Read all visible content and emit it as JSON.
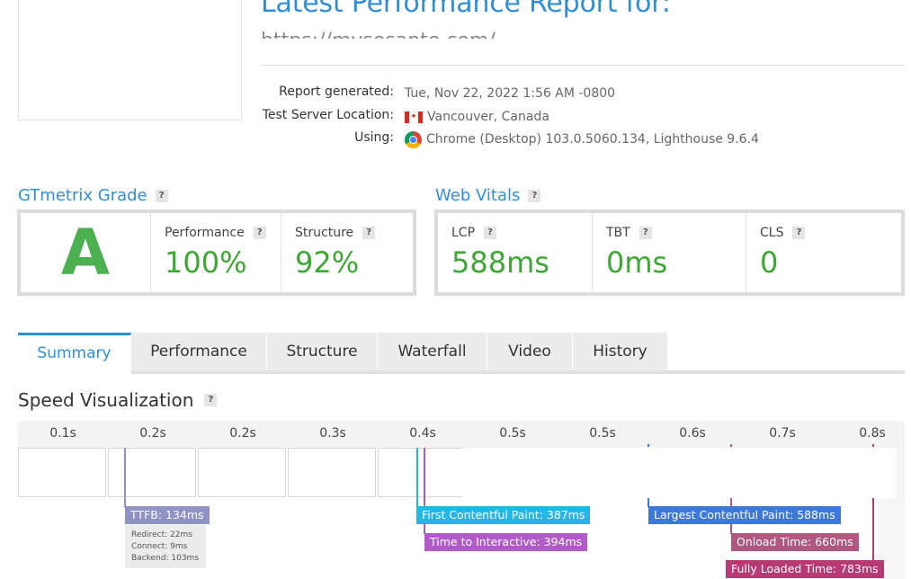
{
  "header": {
    "title": "Latest Performance Report for:",
    "url": "https://mysesante.com/"
  },
  "meta": {
    "report_generated_label": "Report generated:",
    "report_generated_value": "Tue, Nov 22, 2022 1:56 AM -0800",
    "server_location_label": "Test Server Location:",
    "server_location_value": "Vancouver, Canada",
    "using_label": "Using:",
    "using_value": "Chrome (Desktop) 103.0.5060.134, Lighthouse 9.6.4"
  },
  "grade": {
    "heading": "GTmetrix Grade",
    "letter": "A",
    "performance_label": "Performance",
    "performance_value": "100%",
    "structure_label": "Structure",
    "structure_value": "92%"
  },
  "vitals": {
    "heading": "Web Vitals",
    "lcp_label": "LCP",
    "lcp_value": "588ms",
    "tbt_label": "TBT",
    "tbt_value": "0ms",
    "cls_label": "CLS",
    "cls_value": "0"
  },
  "help_glyph": "?",
  "tabs": [
    {
      "label": "Summary",
      "active": true
    },
    {
      "label": "Performance",
      "active": false
    },
    {
      "label": "Structure",
      "active": false
    },
    {
      "label": "Waterfall",
      "active": false
    },
    {
      "label": "Video",
      "active": false
    },
    {
      "label": "History",
      "active": false
    }
  ],
  "speed": {
    "title": "Speed Visualization",
    "ticks": [
      "0.1s",
      "0.2s",
      "0.2s",
      "0.3s",
      "0.4s",
      "0.5s",
      "0.5s",
      "0.6s",
      "0.7s",
      "0.8s"
    ],
    "ttfb": "TTFB: 134ms",
    "redirect": "Redirect: 22ms",
    "connect": "Connect: 9ms",
    "backend": "Backend: 103ms",
    "fcp": "First Contentful Paint: 387ms",
    "tti": "Time to Interactive: 394ms",
    "lcp": "Largest Contentful Paint: 588ms",
    "onload": "Onload Time: 660ms",
    "fully_loaded": "Fully Loaded Time: 783ms"
  },
  "colors": {
    "accent": "#2e8fd6",
    "grade_green": "#4caf50",
    "ttfb": "#8e93c4",
    "fcp": "#27b5e8",
    "tti": "#b15bc8",
    "lcp": "#3c79d8",
    "onload": "#b0587f",
    "fully_loaded": "#b63a73"
  }
}
